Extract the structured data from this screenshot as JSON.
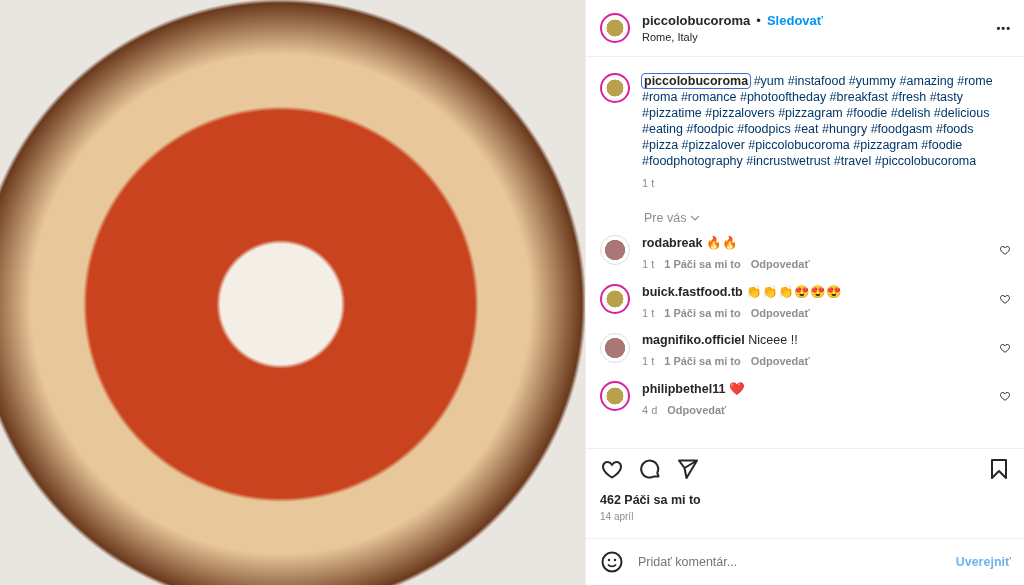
{
  "header": {
    "username": "piccolobucoroma",
    "separator": "•",
    "follow": "Sledovať",
    "location": "Rome, Italy",
    "more": "•••"
  },
  "caption": {
    "username": "piccolobucoroma",
    "focused": true,
    "text": "#yum #instafood #yummy #amazing #rome #roma #romance #photooftheday #breakfast #fresh #tasty #pizzatime #pizzalovers #pizzagram #foodie #delish #delicious #eating #foodpic #foodpics #eat #hungry #foodgasm #foods #pizza #pizzalover #piccolobucoroma #pizzagram #foodie #foodphotography #incrustwetrust #travel #piccolobucoroma",
    "time": "1 t"
  },
  "sort": {
    "label": "Pre vás"
  },
  "comments": [
    {
      "username": "rodabreak",
      "text": "🔥🔥",
      "time": "1 t",
      "likes": "1 Páči sa mi to",
      "reply": "Odpovedať",
      "avatar_ring": false
    },
    {
      "username": "buick.fastfood.tb",
      "text": "👏👏👏😍😍😍",
      "time": "1 t",
      "likes": "1 Páči sa mi to",
      "reply": "Odpovedať",
      "avatar_ring": true
    },
    {
      "username": "magnifiko.officiel",
      "text": "Niceee !!",
      "time": "1 t",
      "likes": "1 Páči sa mi to",
      "reply": "Odpovedať",
      "avatar_ring": false
    },
    {
      "username": "philipbethel11",
      "text": "❤️",
      "time": "4 d",
      "reply": "Odpovedať",
      "avatar_ring": true
    }
  ],
  "likes": "462 Páči sa mi to",
  "date": "14 apríl",
  "composer": {
    "placeholder": "Pridať komentár...",
    "submit": "Uverejniť",
    "submit_disabled": true
  }
}
